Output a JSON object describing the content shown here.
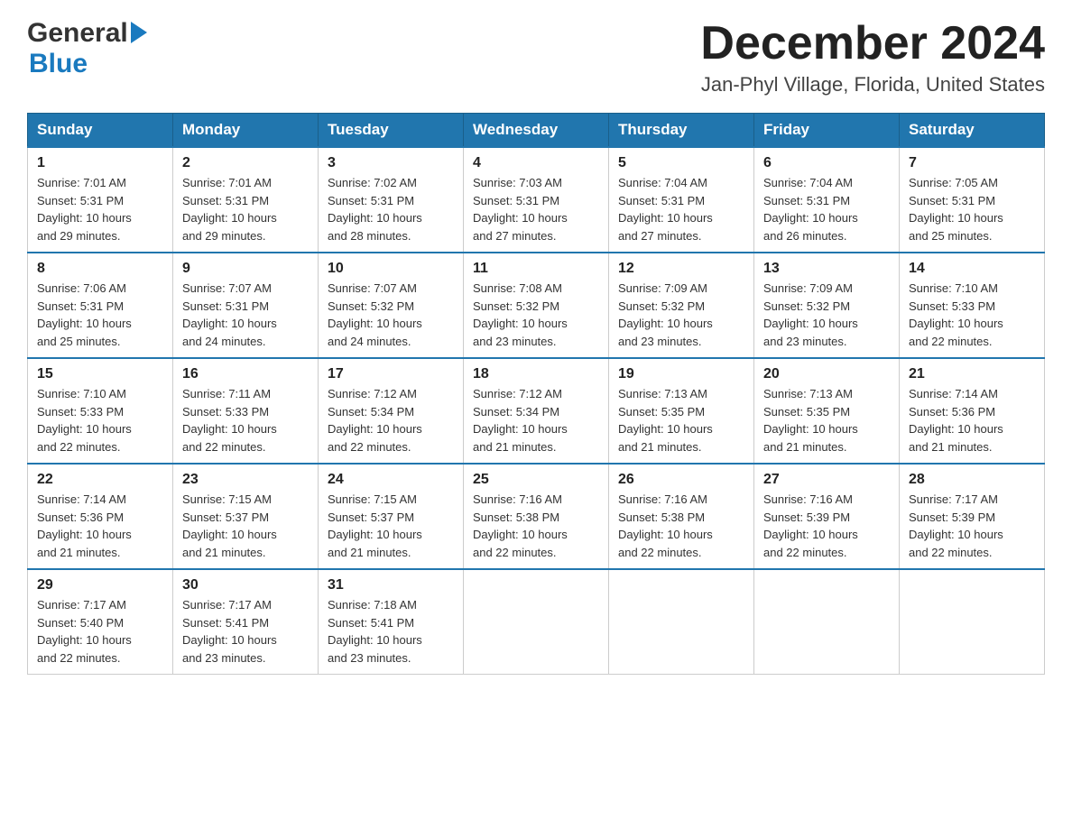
{
  "header": {
    "logo_general": "General",
    "logo_blue": "Blue",
    "month_title": "December 2024",
    "location": "Jan-Phyl Village, Florida, United States"
  },
  "days_of_week": [
    "Sunday",
    "Monday",
    "Tuesday",
    "Wednesday",
    "Thursday",
    "Friday",
    "Saturday"
  ],
  "weeks": [
    [
      {
        "day": "1",
        "sunrise": "7:01 AM",
        "sunset": "5:31 PM",
        "daylight": "10 hours and 29 minutes."
      },
      {
        "day": "2",
        "sunrise": "7:01 AM",
        "sunset": "5:31 PM",
        "daylight": "10 hours and 29 minutes."
      },
      {
        "day": "3",
        "sunrise": "7:02 AM",
        "sunset": "5:31 PM",
        "daylight": "10 hours and 28 minutes."
      },
      {
        "day": "4",
        "sunrise": "7:03 AM",
        "sunset": "5:31 PM",
        "daylight": "10 hours and 27 minutes."
      },
      {
        "day": "5",
        "sunrise": "7:04 AM",
        "sunset": "5:31 PM",
        "daylight": "10 hours and 27 minutes."
      },
      {
        "day": "6",
        "sunrise": "7:04 AM",
        "sunset": "5:31 PM",
        "daylight": "10 hours and 26 minutes."
      },
      {
        "day": "7",
        "sunrise": "7:05 AM",
        "sunset": "5:31 PM",
        "daylight": "10 hours and 25 minutes."
      }
    ],
    [
      {
        "day": "8",
        "sunrise": "7:06 AM",
        "sunset": "5:31 PM",
        "daylight": "10 hours and 25 minutes."
      },
      {
        "day": "9",
        "sunrise": "7:07 AM",
        "sunset": "5:31 PM",
        "daylight": "10 hours and 24 minutes."
      },
      {
        "day": "10",
        "sunrise": "7:07 AM",
        "sunset": "5:32 PM",
        "daylight": "10 hours and 24 minutes."
      },
      {
        "day": "11",
        "sunrise": "7:08 AM",
        "sunset": "5:32 PM",
        "daylight": "10 hours and 23 minutes."
      },
      {
        "day": "12",
        "sunrise": "7:09 AM",
        "sunset": "5:32 PM",
        "daylight": "10 hours and 23 minutes."
      },
      {
        "day": "13",
        "sunrise": "7:09 AM",
        "sunset": "5:32 PM",
        "daylight": "10 hours and 23 minutes."
      },
      {
        "day": "14",
        "sunrise": "7:10 AM",
        "sunset": "5:33 PM",
        "daylight": "10 hours and 22 minutes."
      }
    ],
    [
      {
        "day": "15",
        "sunrise": "7:10 AM",
        "sunset": "5:33 PM",
        "daylight": "10 hours and 22 minutes."
      },
      {
        "day": "16",
        "sunrise": "7:11 AM",
        "sunset": "5:33 PM",
        "daylight": "10 hours and 22 minutes."
      },
      {
        "day": "17",
        "sunrise": "7:12 AM",
        "sunset": "5:34 PM",
        "daylight": "10 hours and 22 minutes."
      },
      {
        "day": "18",
        "sunrise": "7:12 AM",
        "sunset": "5:34 PM",
        "daylight": "10 hours and 21 minutes."
      },
      {
        "day": "19",
        "sunrise": "7:13 AM",
        "sunset": "5:35 PM",
        "daylight": "10 hours and 21 minutes."
      },
      {
        "day": "20",
        "sunrise": "7:13 AM",
        "sunset": "5:35 PM",
        "daylight": "10 hours and 21 minutes."
      },
      {
        "day": "21",
        "sunrise": "7:14 AM",
        "sunset": "5:36 PM",
        "daylight": "10 hours and 21 minutes."
      }
    ],
    [
      {
        "day": "22",
        "sunrise": "7:14 AM",
        "sunset": "5:36 PM",
        "daylight": "10 hours and 21 minutes."
      },
      {
        "day": "23",
        "sunrise": "7:15 AM",
        "sunset": "5:37 PM",
        "daylight": "10 hours and 21 minutes."
      },
      {
        "day": "24",
        "sunrise": "7:15 AM",
        "sunset": "5:37 PM",
        "daylight": "10 hours and 21 minutes."
      },
      {
        "day": "25",
        "sunrise": "7:16 AM",
        "sunset": "5:38 PM",
        "daylight": "10 hours and 22 minutes."
      },
      {
        "day": "26",
        "sunrise": "7:16 AM",
        "sunset": "5:38 PM",
        "daylight": "10 hours and 22 minutes."
      },
      {
        "day": "27",
        "sunrise": "7:16 AM",
        "sunset": "5:39 PM",
        "daylight": "10 hours and 22 minutes."
      },
      {
        "day": "28",
        "sunrise": "7:17 AM",
        "sunset": "5:39 PM",
        "daylight": "10 hours and 22 minutes."
      }
    ],
    [
      {
        "day": "29",
        "sunrise": "7:17 AM",
        "sunset": "5:40 PM",
        "daylight": "10 hours and 22 minutes."
      },
      {
        "day": "30",
        "sunrise": "7:17 AM",
        "sunset": "5:41 PM",
        "daylight": "10 hours and 23 minutes."
      },
      {
        "day": "31",
        "sunrise": "7:18 AM",
        "sunset": "5:41 PM",
        "daylight": "10 hours and 23 minutes."
      },
      null,
      null,
      null,
      null
    ]
  ],
  "labels": {
    "sunrise": "Sunrise:",
    "sunset": "Sunset:",
    "daylight": "Daylight:"
  }
}
